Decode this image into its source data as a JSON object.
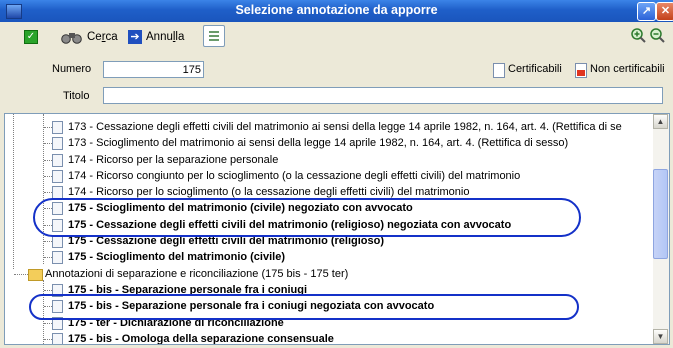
{
  "window": {
    "title": "Selezione annotazione da apporre"
  },
  "toolbar": {
    "cerca_prefix": "Ce",
    "cerca_underline": "r",
    "cerca_suffix": "ca",
    "annulla_prefix": "Annu",
    "annulla_underline": "l",
    "annulla_suffix": "la"
  },
  "form": {
    "numero_label": "Numero",
    "numero_value": "175",
    "titolo_label": "Titolo",
    "titolo_value": "",
    "certificabili": "Certificabili",
    "non_certificabili": "Non certificabili"
  },
  "tree": {
    "rows": [
      {
        "text": "173 - Cessazione degli effetti civili del matrimonio ai sensi della legge 14 aprile 1982, n. 164, art. 4. (Rettifica di se",
        "bold": false,
        "type": "doc"
      },
      {
        "text": "173 - Scioglimento del matrimonio ai sensi della legge 14 aprile 1982, n. 164, art. 4. (Rettifica di sesso)",
        "bold": false,
        "type": "doc"
      },
      {
        "text": "174 - Ricorso per la separazione personale",
        "bold": false,
        "type": "doc"
      },
      {
        "text": "174 - Ricorso congiunto per lo scioglimento (o la cessazione degli effetti civili) del matrimonio",
        "bold": false,
        "type": "doc"
      },
      {
        "text": "174 - Ricorso per lo scioglimento (o la cessazione degli effetti civili) del matrimonio",
        "bold": false,
        "type": "doc"
      },
      {
        "text": "175 - Scioglimento del matrimonio (civile) negoziato con avvocato",
        "bold": true,
        "type": "doc"
      },
      {
        "text": "175 - Cessazione degli effetti civili del matrimonio (religioso) negoziata con avvocato",
        "bold": true,
        "type": "doc"
      },
      {
        "text": "175 - Cessazione degli effetti civili del matrimonio (religioso)",
        "bold": true,
        "type": "doc"
      },
      {
        "text": "175 - Scioglimento del matrimonio (civile)",
        "bold": true,
        "type": "doc"
      },
      {
        "text": "Annotazioni di separazione e riconciliazione (175 bis - 175 ter)",
        "bold": false,
        "type": "folder"
      },
      {
        "text": "175 - bis - Separazione personale fra i coniugi",
        "bold": true,
        "type": "doc"
      },
      {
        "text": "175 - bis - Separazione personale fra i coniugi negoziata con avvocato",
        "bold": true,
        "type": "doc"
      },
      {
        "text": "175 - ter - Dichiarazione di riconciliazione",
        "bold": true,
        "type": "doc"
      },
      {
        "text": "175 - bis - Omologa della separazione consensuale",
        "bold": true,
        "type": "doc"
      }
    ]
  },
  "colors": {
    "title_bar": "#1f5fc9",
    "highlight_ellipse": "#1431c8",
    "window_bg": "#ece9d8"
  }
}
